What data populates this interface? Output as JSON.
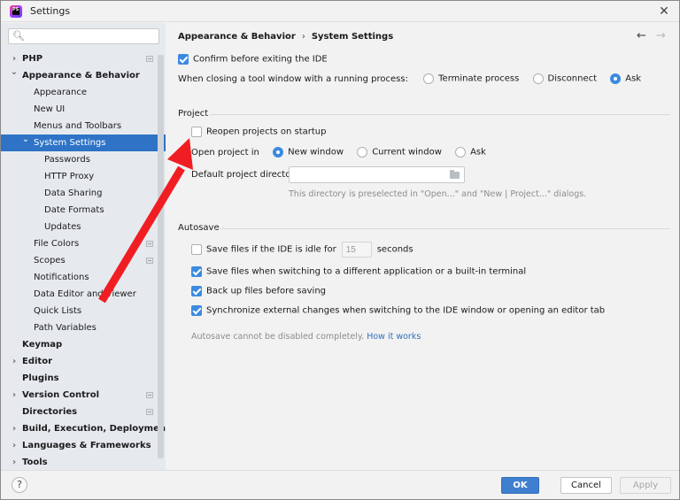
{
  "window": {
    "title": "Settings",
    "app_icon": "phpstorm-icon",
    "close_icon": "close-icon"
  },
  "sidebar": {
    "search": {
      "value": "",
      "placeholder": "",
      "icon": "search-icon"
    },
    "items": [
      {
        "label": "PHP",
        "level": 0,
        "bold": true,
        "expandable": true,
        "expanded": false,
        "project_icon": true
      },
      {
        "label": "Appearance & Behavior",
        "level": 0,
        "bold": true,
        "expandable": true,
        "expanded": true,
        "project_icon": false
      },
      {
        "label": "Appearance",
        "level": 1,
        "bold": false,
        "expandable": false,
        "project_icon": false
      },
      {
        "label": "New UI",
        "level": 1,
        "bold": false,
        "expandable": false,
        "project_icon": false
      },
      {
        "label": "Menus and Toolbars",
        "level": 1,
        "bold": false,
        "expandable": false,
        "project_icon": false
      },
      {
        "label": "System Settings",
        "level": 1,
        "bold": false,
        "expandable": true,
        "expanded": true,
        "selected": true,
        "project_icon": false
      },
      {
        "label": "Passwords",
        "level": 2,
        "bold": false,
        "expandable": false,
        "project_icon": false
      },
      {
        "label": "HTTP Proxy",
        "level": 2,
        "bold": false,
        "expandable": false,
        "project_icon": false
      },
      {
        "label": "Data Sharing",
        "level": 2,
        "bold": false,
        "expandable": false,
        "project_icon": false
      },
      {
        "label": "Date Formats",
        "level": 2,
        "bold": false,
        "expandable": false,
        "project_icon": false
      },
      {
        "label": "Updates",
        "level": 2,
        "bold": false,
        "expandable": false,
        "project_icon": false
      },
      {
        "label": "File Colors",
        "level": 1,
        "bold": false,
        "expandable": false,
        "project_icon": true
      },
      {
        "label": "Scopes",
        "level": 1,
        "bold": false,
        "expandable": false,
        "project_icon": true
      },
      {
        "label": "Notifications",
        "level": 1,
        "bold": false,
        "expandable": false,
        "project_icon": false
      },
      {
        "label": "Data Editor and Viewer",
        "level": 1,
        "bold": false,
        "expandable": false,
        "project_icon": false
      },
      {
        "label": "Quick Lists",
        "level": 1,
        "bold": false,
        "expandable": false,
        "project_icon": false
      },
      {
        "label": "Path Variables",
        "level": 1,
        "bold": false,
        "expandable": false,
        "project_icon": false
      },
      {
        "label": "Keymap",
        "level": 0,
        "bold": true,
        "expandable": false,
        "project_icon": false
      },
      {
        "label": "Editor",
        "level": 0,
        "bold": true,
        "expandable": true,
        "expanded": false,
        "project_icon": false
      },
      {
        "label": "Plugins",
        "level": 0,
        "bold": true,
        "expandable": false,
        "project_icon": false
      },
      {
        "label": "Version Control",
        "level": 0,
        "bold": true,
        "expandable": true,
        "expanded": false,
        "project_icon": true
      },
      {
        "label": "Directories",
        "level": 0,
        "bold": true,
        "expandable": false,
        "project_icon": true
      },
      {
        "label": "Build, Execution, Deployment",
        "level": 0,
        "bold": true,
        "expandable": true,
        "expanded": false,
        "project_icon": false
      },
      {
        "label": "Languages & Frameworks",
        "level": 0,
        "bold": true,
        "expandable": true,
        "expanded": false,
        "project_icon": false
      },
      {
        "label": "Tools",
        "level": 0,
        "bold": true,
        "expandable": true,
        "expanded": false,
        "project_icon": false
      }
    ]
  },
  "content": {
    "breadcrumb": {
      "parent": "Appearance & Behavior",
      "separator": "›",
      "current": "System Settings"
    },
    "nav": {
      "back": "←",
      "forward": "→"
    },
    "confirm_exit": {
      "label": "Confirm before exiting the IDE",
      "checked": true
    },
    "closing_tool_window": {
      "label": "When closing a tool window with a running process:",
      "options": [
        {
          "label": "Terminate process",
          "selected": false
        },
        {
          "label": "Disconnect",
          "selected": false
        },
        {
          "label": "Ask",
          "selected": true
        }
      ]
    },
    "project": {
      "title": "Project",
      "reopen": {
        "label": "Reopen projects on startup",
        "checked": false
      },
      "open_in": {
        "label": "Open project in",
        "options": [
          {
            "label": "New window",
            "selected": true
          },
          {
            "label": "Current window",
            "selected": false
          },
          {
            "label": "Ask",
            "selected": false
          }
        ]
      },
      "default_dir": {
        "label": "Default project directory:",
        "value": "",
        "hint": "This directory is preselected in \"Open...\" and \"New | Project...\" dialogs."
      }
    },
    "autosave": {
      "title": "Autosave",
      "idle": {
        "label_before": "Save files if the IDE is idle for",
        "value": "15",
        "label_after": "seconds",
        "checked": false
      },
      "switch_app": {
        "label": "Save files when switching to a different application or a built-in terminal",
        "checked": true
      },
      "backup": {
        "label": "Back up files before saving",
        "checked": true
      },
      "sync": {
        "label": "Synchronize external changes when switching to the IDE window or opening an editor tab",
        "checked": true
      },
      "note": "Autosave cannot be disabled completely.",
      "link": "How it works"
    }
  },
  "footer": {
    "help": "?",
    "ok": "OK",
    "cancel": "Cancel",
    "apply": "Apply"
  },
  "annotation": {
    "type": "arrow",
    "color": "#f01e23",
    "target": "reopen-projects-checkbox"
  }
}
